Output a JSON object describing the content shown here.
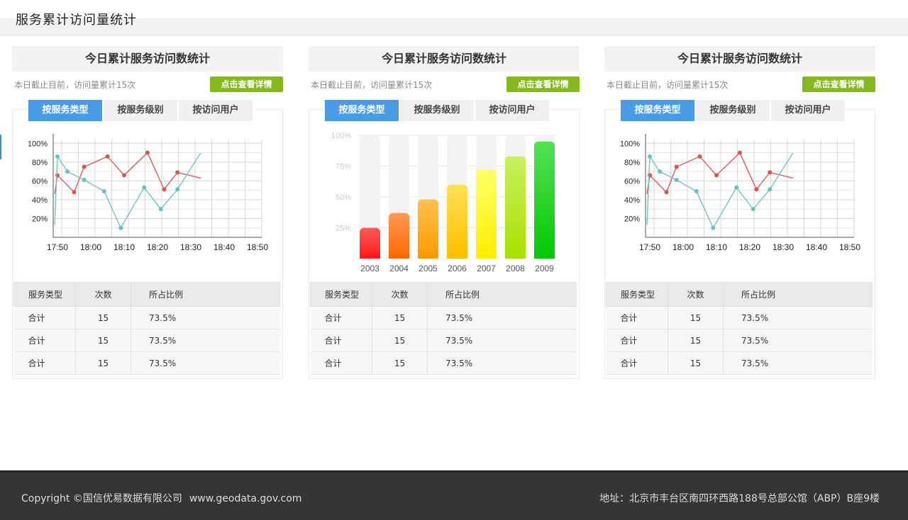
{
  "page_title": "服务累计访问量统计",
  "panels": [
    {
      "title": "今日累计服务访问数统计",
      "summary": "本日截止目前，访问量累计15次",
      "detail_button": "点击查看详情",
      "tabs": [
        "按服务类型",
        "按服务级别",
        "按访问用户"
      ],
      "active_tab": 0,
      "table": {
        "headers": [
          "服务类型",
          "次数",
          "所占比例"
        ],
        "rows": [
          [
            "合计",
            "15",
            "73.5%"
          ],
          [
            "合计",
            "15",
            "73.5%"
          ],
          [
            "合计",
            "15",
            "73.5%"
          ]
        ]
      }
    },
    {
      "title": "今日累计服务访问数统计",
      "summary": "本日截止目前，访问量累计15次",
      "detail_button": "点击查看详情",
      "tabs": [
        "按服务类型",
        "按服务级别",
        "按访问用户"
      ],
      "active_tab": 0,
      "table": {
        "headers": [
          "服务类型",
          "次数",
          "所占比例"
        ],
        "rows": [
          [
            "合计",
            "15",
            "73.5%"
          ],
          [
            "合计",
            "15",
            "73.5%"
          ],
          [
            "合计",
            "15",
            "73.5%"
          ]
        ]
      }
    },
    {
      "title": "今日累计服务访问数统计",
      "summary": "本日截止目前，访问量累计15次",
      "detail_button": "点击查看详情",
      "tabs": [
        "按服务类型",
        "按服务级别",
        "按访问用户"
      ],
      "active_tab": 0,
      "table": {
        "headers": [
          "服务类型",
          "次数",
          "所占比例"
        ],
        "rows": [
          [
            "合计",
            "15",
            "73.5%"
          ],
          [
            "合计",
            "15",
            "73.5%"
          ],
          [
            "合计",
            "15",
            "73.5%"
          ]
        ]
      }
    }
  ],
  "chart_data": [
    {
      "type": "line",
      "x": [
        "17:50",
        "18:00",
        "18:10",
        "18:20",
        "18:30",
        "18:40",
        "18:50"
      ],
      "y_ticks": [
        "20%",
        "40%",
        "60%",
        "80%",
        "100%"
      ],
      "ylim": [
        0,
        110
      ],
      "grid": true,
      "series": [
        {
          "color": "#d9534f",
          "points": [
            [
              -5,
              46
            ],
            [
              0,
              66
            ],
            [
              5,
              48
            ],
            [
              8,
              75
            ],
            [
              15,
              86
            ],
            [
              20,
              66
            ],
            [
              27,
              90
            ],
            [
              32,
              51
            ],
            [
              36,
              69
            ],
            [
              43,
              63
            ]
          ]
        },
        {
          "color": "#6bbfbf",
          "points": [
            [
              -5,
              13
            ],
            [
              0,
              86
            ],
            [
              3,
              70
            ],
            [
              8,
              61
            ],
            [
              14,
              49
            ],
            [
              19,
              10
            ],
            [
              26,
              53
            ],
            [
              31,
              30
            ],
            [
              36,
              51
            ],
            [
              43,
              90
            ]
          ]
        }
      ]
    },
    {
      "type": "bar",
      "categories": [
        "2003",
        "2004",
        "2005",
        "2006",
        "2007",
        "2008",
        "2009"
      ],
      "values": [
        25,
        37,
        48,
        60,
        72,
        83,
        95
      ],
      "y_ticks": [
        "25%",
        "50%",
        "75%",
        "100%"
      ],
      "ylim": [
        0,
        100
      ],
      "colors": [
        [
          "#ff1a1a",
          "#ff5a5a"
        ],
        [
          "#ff6600",
          "#ff9a55"
        ],
        [
          "#ff9900",
          "#ffc04d"
        ],
        [
          "#ffbf00",
          "#ffdf55"
        ],
        [
          "#ffee00",
          "#ffff66"
        ],
        [
          "#a8e000",
          "#c8f060"
        ],
        [
          "#00c800",
          "#55e055"
        ]
      ]
    },
    {
      "type": "line",
      "x": [
        "17:50",
        "18:00",
        "18:10",
        "18:20",
        "18:30",
        "18:40",
        "18:50"
      ],
      "y_ticks": [
        "20%",
        "40%",
        "60%",
        "80%",
        "100%"
      ],
      "ylim": [
        0,
        110
      ],
      "grid": true,
      "series": [
        {
          "color": "#d9534f",
          "points": [
            [
              -5,
              46
            ],
            [
              0,
              66
            ],
            [
              5,
              48
            ],
            [
              8,
              75
            ],
            [
              15,
              86
            ],
            [
              20,
              66
            ],
            [
              27,
              90
            ],
            [
              32,
              51
            ],
            [
              36,
              69
            ],
            [
              43,
              63
            ]
          ]
        },
        {
          "color": "#6bbfbf",
          "points": [
            [
              -5,
              13
            ],
            [
              0,
              86
            ],
            [
              3,
              70
            ],
            [
              8,
              61
            ],
            [
              14,
              49
            ],
            [
              19,
              10
            ],
            [
              26,
              53
            ],
            [
              31,
              30
            ],
            [
              36,
              51
            ],
            [
              43,
              90
            ]
          ]
        }
      ]
    }
  ],
  "footer": {
    "copyright": "Copyright ©国信优易数据有限公司",
    "website": "www.geodata.gov.com",
    "address": "地址：北京市丰台区南四环西路188号总部公馆（ABP）B座9楼"
  }
}
